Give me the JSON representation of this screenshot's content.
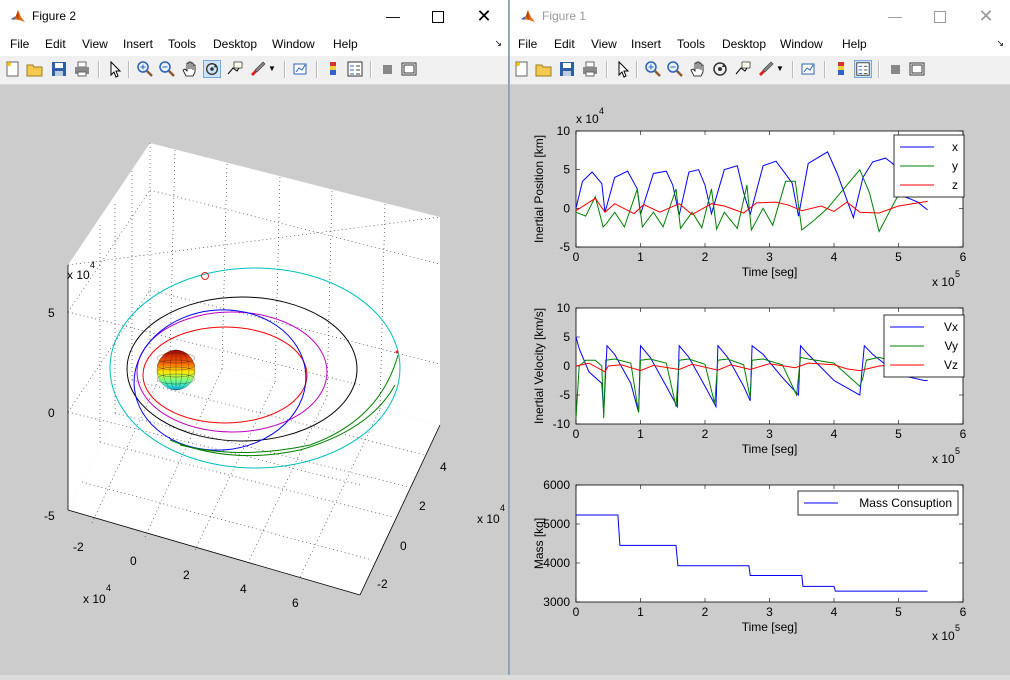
{
  "figure2": {
    "title": "Figure 2",
    "menu": [
      "File",
      "Edit",
      "View",
      "Insert",
      "Tools",
      "Desktop",
      "Window",
      "Help"
    ],
    "axes3d": {
      "z_ticks": [
        "5",
        "0",
        "-5"
      ],
      "z_exp_base": "x 10",
      "z_exp_pow": "4",
      "x_ticks": [
        "-2",
        "0",
        "2",
        "4",
        "6"
      ],
      "x_exp_base": "x 10",
      "x_exp_pow": "4",
      "y_ticks": [
        "4",
        "2",
        "0",
        "-2"
      ],
      "y_exp_base": "x 10",
      "y_exp_pow": "4"
    }
  },
  "figure1": {
    "title": "Figure 1",
    "menu": [
      "File",
      "Edit",
      "View",
      "Insert",
      "Tools",
      "Desktop",
      "Window",
      "Help"
    ]
  },
  "colors": {
    "x": "#0000ff",
    "y": "#008000",
    "z": "#ff0000",
    "orbit_cyan": "#00bfbf",
    "orbit_magenta": "#bf00bf",
    "orbit_black": "#000000"
  },
  "chart_data": [
    {
      "type": "line",
      "ylabel": "Inertial Position [km]",
      "xlabel": "Time [seg]",
      "x_exponent": "x 10^5",
      "y_exponent": "x 10^4",
      "xlim": [
        0,
        6
      ],
      "ylim": [
        -5,
        10
      ],
      "xticks": [
        "0",
        "1",
        "2",
        "3",
        "4",
        "5",
        "6"
      ],
      "yticks": [
        "10",
        "5",
        "0",
        "-5"
      ],
      "legend": [
        "x",
        "y",
        "z"
      ],
      "series": [
        {
          "name": "x",
          "x": [
            0,
            0.1,
            0.25,
            0.4,
            0.45,
            0.6,
            0.8,
            0.95,
            1.0,
            1.2,
            1.4,
            1.5,
            1.6,
            1.75,
            1.9,
            2.0,
            2.1,
            2.3,
            2.5,
            2.6,
            2.7,
            2.9,
            3.1,
            3.35,
            3.45,
            3.6,
            3.9,
            4.05,
            4.3,
            4.45,
            4.6,
            4.8,
            4.95,
            5.1,
            5.3,
            5.45
          ],
          "values": [
            0,
            3.5,
            4.7,
            3.2,
            -0.5,
            4,
            4.8,
            2.5,
            -0.8,
            4.5,
            4.8,
            3,
            -0.9,
            4.7,
            5,
            3,
            -0.7,
            5,
            5.5,
            2,
            -0.8,
            5.5,
            6.1,
            3.3,
            -1,
            5.8,
            7.3,
            4.5,
            -1.2,
            4,
            6,
            6.5,
            5.5,
            1.5,
            0.8,
            -0.2
          ]
        },
        {
          "name": "y",
          "x": [
            0,
            0.15,
            0.3,
            0.42,
            0.47,
            0.6,
            0.75,
            0.95,
            1.03,
            1.2,
            1.35,
            1.55,
            1.62,
            1.8,
            1.95,
            2.1,
            2.18,
            2.3,
            2.5,
            2.65,
            2.72,
            2.9,
            3.05,
            3.25,
            3.4,
            3.5,
            3.7,
            3.9,
            4.2,
            4.4,
            4.55,
            4.7,
            4.95,
            5.2,
            5.45
          ],
          "values": [
            -0.5,
            -1,
            1.5,
            -2.4,
            -2,
            -0.5,
            -2.4,
            2.5,
            -2.4,
            -0.5,
            -2.4,
            2.5,
            -2.6,
            -0.5,
            -2.5,
            2.5,
            -2.7,
            -0.5,
            -2.6,
            3,
            -2.8,
            0,
            -2.2,
            3.5,
            3.5,
            -2.8,
            -1.5,
            0,
            3,
            5,
            2,
            -3,
            1,
            4.5,
            5
          ]
        },
        {
          "name": "z",
          "x": [
            0,
            0.3,
            0.45,
            0.6,
            0.9,
            1.05,
            1.3,
            1.6,
            1.8,
            2.1,
            2.3,
            2.6,
            2.8,
            3.1,
            3.3,
            3.5,
            3.8,
            4.0,
            4.2,
            4.4,
            4.7,
            5.0,
            5.3,
            5.45
          ],
          "values": [
            -0.3,
            1.3,
            -0.5,
            0.6,
            -0.7,
            0.5,
            -0.5,
            0.6,
            -0.8,
            0.6,
            0.3,
            -0.6,
            0.7,
            0.8,
            0.4,
            -0.3,
            0.3,
            -0.4,
            0.8,
            -0.5,
            -0.6,
            0.3,
            0.7,
            0.9
          ]
        }
      ]
    },
    {
      "type": "line",
      "ylabel": "Inertial Velocity [km/s]",
      "xlabel": "Time [seg]",
      "x_exponent": "x 10^5",
      "xlim": [
        0,
        6
      ],
      "ylim": [
        -10,
        10
      ],
      "xticks": [
        "0",
        "1",
        "2",
        "3",
        "4",
        "5",
        "6"
      ],
      "yticks": [
        "10",
        "5",
        "0",
        "-5",
        "-10"
      ],
      "legend": [
        "Vx",
        "Vy",
        "Vz"
      ],
      "series": [
        {
          "name": "Vx",
          "x": [
            0,
            0.05,
            0.2,
            0.4,
            0.43,
            0.48,
            0.6,
            0.85,
            0.97,
            1.0,
            1.15,
            1.4,
            1.57,
            1.6,
            1.75,
            2.0,
            2.17,
            2.2,
            2.35,
            2.6,
            2.7,
            2.73,
            2.9,
            3.2,
            3.45,
            3.48,
            3.6,
            4.0,
            4.4,
            4.47,
            4.6,
            5.0,
            5.4,
            5.45
          ],
          "values": [
            5,
            3,
            -1,
            -3,
            -8,
            3.5,
            2,
            -3,
            -8,
            3.5,
            1.5,
            -3.5,
            -7,
            3.5,
            1.5,
            -3.5,
            -7,
            3.5,
            1.5,
            -3.5,
            -6,
            3.5,
            2,
            -2,
            -5,
            3.5,
            2,
            -2.5,
            -5,
            3.5,
            2,
            -1.5,
            -2.5,
            -2.5
          ]
        },
        {
          "name": "Vy",
          "x": [
            0,
            0.05,
            0.15,
            0.3,
            0.4,
            0.43,
            0.46,
            0.6,
            0.85,
            0.97,
            1.0,
            1.15,
            1.4,
            1.55,
            1.6,
            1.75,
            2.0,
            2.15,
            2.2,
            2.35,
            2.6,
            2.7,
            2.73,
            2.9,
            3.2,
            3.42,
            3.48,
            3.6,
            4.0,
            4.4,
            4.45,
            4.5,
            4.7,
            5.0,
            5.45
          ],
          "values": [
            -9,
            0,
            1,
            1,
            0,
            -9,
            1,
            1.2,
            0.5,
            -8,
            1,
            1.2,
            0.5,
            -7,
            1,
            1.2,
            0.3,
            -6.5,
            1,
            1.2,
            0.2,
            -5.5,
            1,
            1.2,
            0.2,
            -5,
            1.5,
            1.2,
            0.5,
            -3.5,
            -2,
            1,
            1.5,
            0.5,
            0.5
          ]
        },
        {
          "name": "Vz",
          "x": [
            0,
            0.2,
            0.45,
            0.5,
            0.7,
            1.0,
            1.2,
            1.6,
            1.8,
            2.2,
            2.4,
            2.7,
            3.0,
            3.4,
            3.6,
            4.0,
            4.2,
            4.4,
            4.7,
            5.0,
            5.3,
            5.45
          ],
          "values": [
            0,
            0.5,
            -1,
            0,
            0.2,
            -0.8,
            0.1,
            -0.6,
            0.3,
            -0.7,
            0.2,
            -0.6,
            0.4,
            -0.3,
            0.5,
            0.2,
            -0.5,
            -0.8,
            0,
            0.3,
            0.6,
            0.8
          ]
        }
      ]
    },
    {
      "type": "line",
      "ylabel": "Mass [kg]",
      "xlabel": "Time [seg]",
      "x_exponent": "x 10^5",
      "xlim": [
        0,
        6
      ],
      "ylim": [
        3000,
        6000
      ],
      "xticks": [
        "0",
        "1",
        "2",
        "3",
        "4",
        "5",
        "6"
      ],
      "yticks": [
        "6000",
        "5000",
        "4000",
        "3000"
      ],
      "legend": [
        "Mass Consuption"
      ],
      "series": [
        {
          "name": "Mass Consuption",
          "x": [
            0,
            0.65,
            0.68,
            1.55,
            1.58,
            2.68,
            2.7,
            3.5,
            3.52,
            4.0,
            4.02,
            5.45
          ],
          "values": [
            5230,
            5230,
            4450,
            4450,
            3930,
            3930,
            3680,
            3680,
            3400,
            3400,
            3280,
            3280
          ]
        }
      ]
    }
  ]
}
